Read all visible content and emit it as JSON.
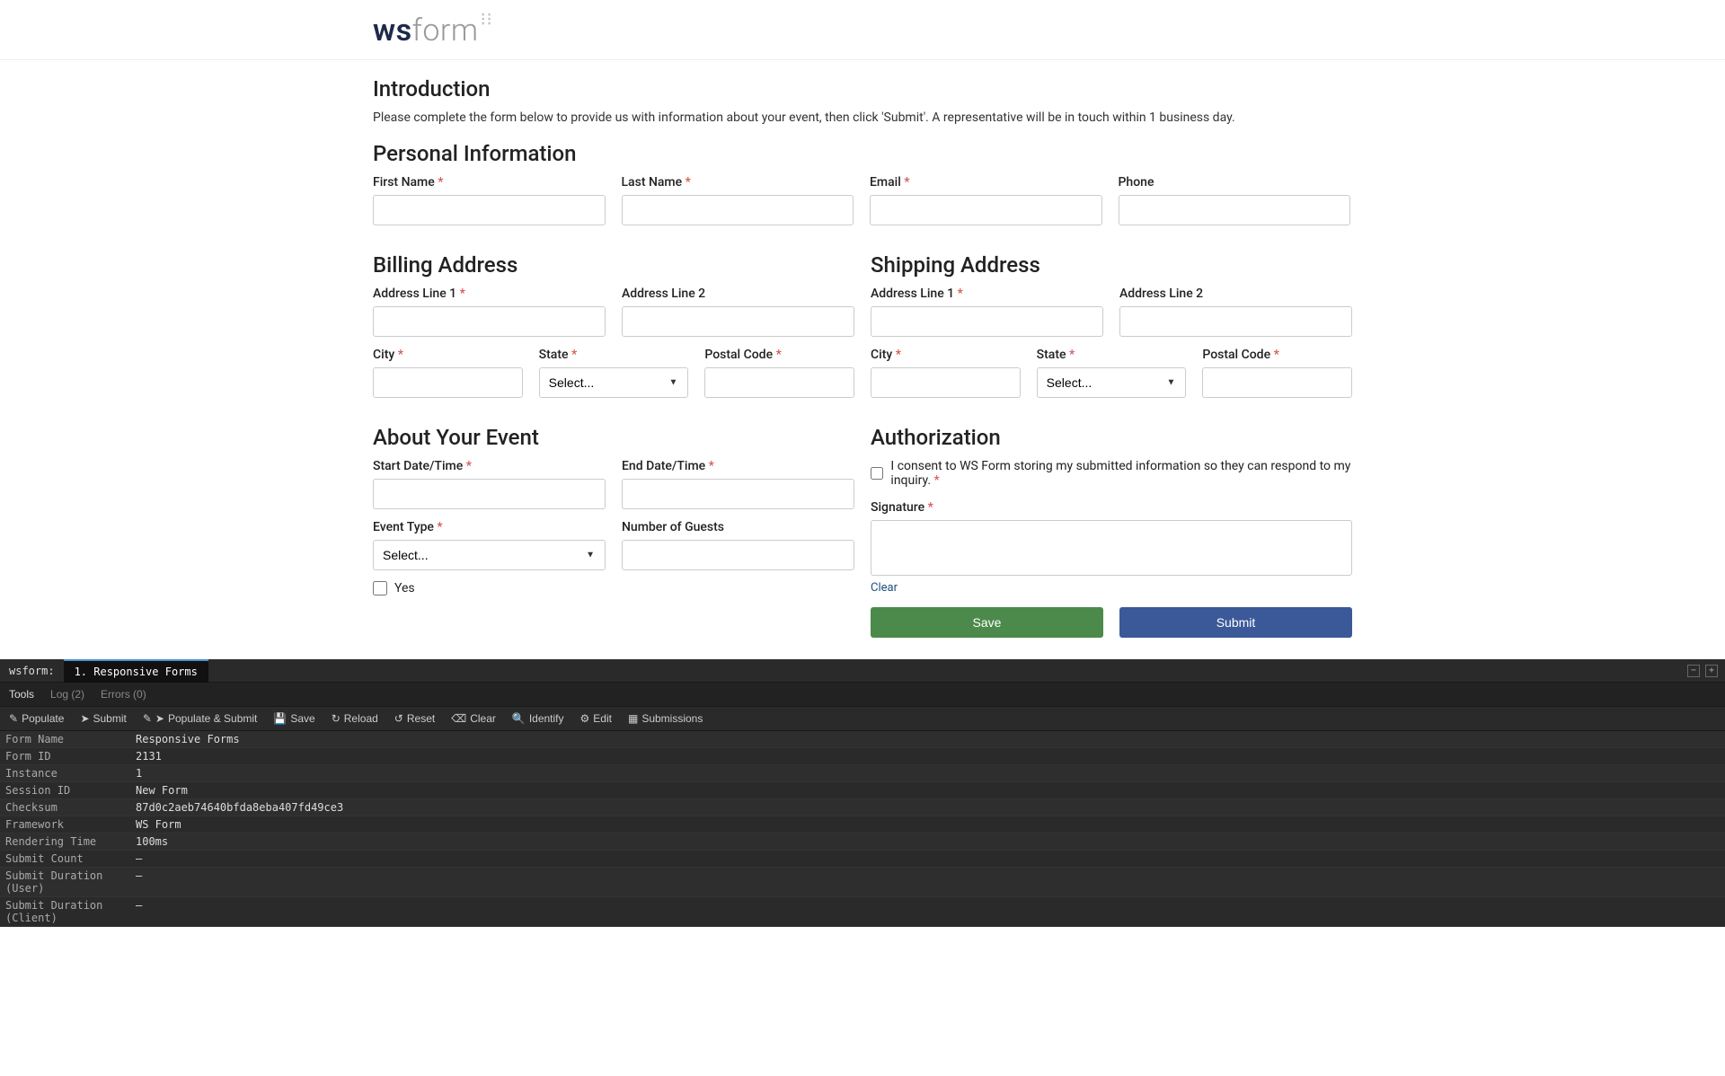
{
  "logo": {
    "ws": "ws",
    "form": "form"
  },
  "sections": {
    "intro_title": "Introduction",
    "intro_text": "Please complete the form below to provide us with information about your event, then click 'Submit'.  A representative will be in touch within 1 business day.",
    "personal_title": "Personal Information",
    "billing_title": "Billing Address",
    "shipping_title": "Shipping Address",
    "event_title": "About Your Event",
    "auth_title": "Authorization"
  },
  "labels": {
    "first_name": "First Name",
    "last_name": "Last Name",
    "email": "Email",
    "phone": "Phone",
    "addr1": "Address Line 1",
    "addr2": "Address Line 2",
    "city": "City",
    "state": "State",
    "postal": "Postal Code",
    "start_dt": "Start Date/Time",
    "end_dt": "End Date/Time",
    "event_type": "Event Type",
    "guests": "Number of Guests",
    "yes": "Yes",
    "consent": "I consent to WS Form storing my submitted information so they can respond to my inquiry.",
    "signature": "Signature",
    "clear": "Clear",
    "select_placeholder": "Select..."
  },
  "buttons": {
    "save": "Save",
    "submit": "Submit"
  },
  "debug": {
    "brand": "wsform:",
    "tab": "1. Responsive Forms",
    "tabs2": {
      "tools": "Tools",
      "log": "Log (2)",
      "errors": "Errors (0)"
    },
    "toolbar": {
      "populate": "Populate",
      "submit": "Submit",
      "populate_submit": "Populate & Submit",
      "save": "Save",
      "reload": "Reload",
      "reset": "Reset",
      "clear": "Clear",
      "identify": "Identify",
      "edit": "Edit",
      "submissions": "Submissions"
    },
    "rows": [
      {
        "k": "Form Name",
        "v": "Responsive Forms"
      },
      {
        "k": "Form ID",
        "v": "2131"
      },
      {
        "k": "Instance",
        "v": "1"
      },
      {
        "k": "Session ID",
        "v": "New Form"
      },
      {
        "k": "Checksum",
        "v": "87d0c2aeb74640bfda8eba407fd49ce3"
      },
      {
        "k": "Framework",
        "v": "WS Form"
      },
      {
        "k": "Rendering Time",
        "v": "100ms"
      },
      {
        "k": "Submit Count",
        "v": "–"
      },
      {
        "k": "Submit Duration (User)",
        "v": "–"
      },
      {
        "k": "Submit Duration (Client)",
        "v": "–"
      }
    ]
  }
}
